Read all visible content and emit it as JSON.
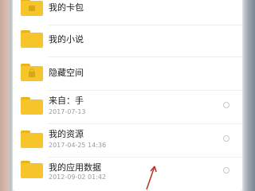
{
  "folders": [
    {
      "name": "我的卡包",
      "date": "",
      "icon": "folder-icon"
    },
    {
      "name": "我的小说",
      "date": "",
      "icon": "folder-icon"
    },
    {
      "name": "隐藏空间",
      "date": "",
      "icon": "locked-folder-icon"
    },
    {
      "name": "来自：手",
      "date": "2017-07-13",
      "icon": "folder-icon"
    },
    {
      "name": "我的资源",
      "date": "2017-04-25 14:36",
      "icon": "folder-icon"
    },
    {
      "name": "我的应用数据",
      "date": "2012-09-02 01:42",
      "icon": "folder-icon"
    }
  ],
  "colors": {
    "folder": "#f5c52a",
    "folder_tab": "#e9b419",
    "pointer": "#c0392b"
  }
}
